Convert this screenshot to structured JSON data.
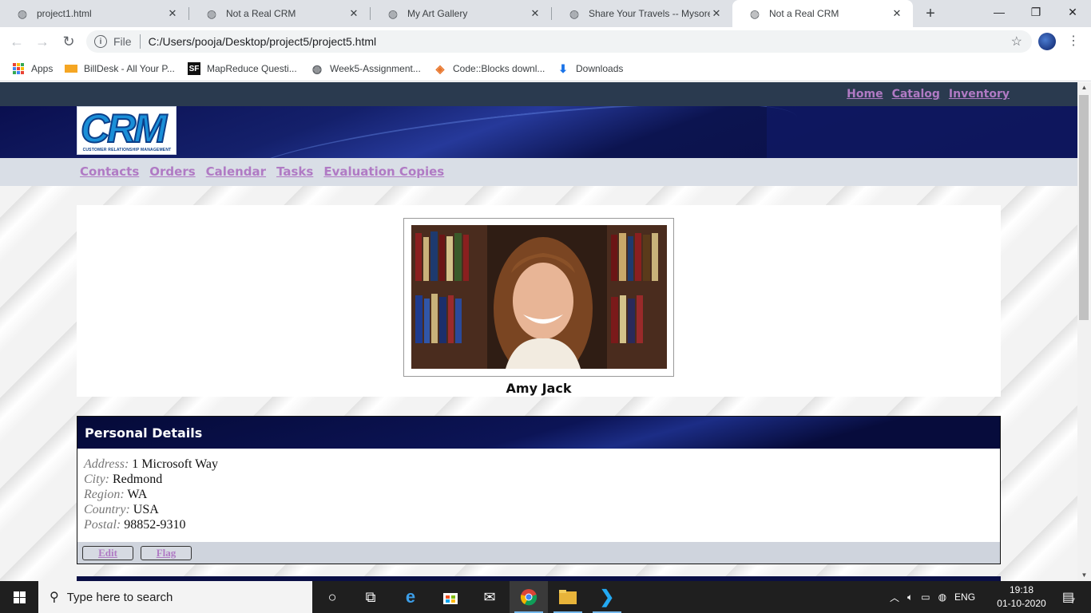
{
  "browser": {
    "tabs": [
      {
        "title": "project1.html"
      },
      {
        "title": "Not a Real CRM"
      },
      {
        "title": "My Art Gallery"
      },
      {
        "title": "Share Your Travels -- Mysore -"
      },
      {
        "title": "Not a Real CRM",
        "active": true
      }
    ],
    "new_tab_icon": "plus-icon",
    "address": {
      "scheme_label": "File",
      "url": "C:/Users/pooja/Desktop/project5/project5.html"
    },
    "bookmarks": [
      {
        "label": "Apps",
        "icon": "apps-grid-icon"
      },
      {
        "label": "BillDesk - All Your P...",
        "icon": "billdesk-icon"
      },
      {
        "label": "MapReduce Questi...",
        "icon": "sf-icon",
        "icon_text": "SF"
      },
      {
        "label": "Week5-Assignment...",
        "icon": "globe-icon"
      },
      {
        "label": "Code::Blocks downl...",
        "icon": "codeblocks-icon"
      },
      {
        "label": "Downloads",
        "icon": "download-icon"
      }
    ]
  },
  "page": {
    "top_links": [
      "Home",
      "Catalog",
      "Inventory"
    ],
    "logo": {
      "text": "CRM",
      "subtitle": "CUSTOMER RELATIONSHIP MANAGEMENT"
    },
    "main_nav": [
      "Contacts",
      "Orders",
      "Calendar",
      "Tasks",
      "Evaluation Copies"
    ],
    "contact_name": "Amy Jack",
    "details": {
      "heading": "Personal Details",
      "fields": [
        {
          "label": "Address:",
          "value": "1 Microsoft Way"
        },
        {
          "label": "City:",
          "value": "Redmond"
        },
        {
          "label": "Region:",
          "value": "WA"
        },
        {
          "label": "Country:",
          "value": "USA"
        },
        {
          "label": "Postal:",
          "value": "98852-9310"
        }
      ],
      "buttons": [
        "Edit",
        "Flag"
      ]
    },
    "colors": {
      "link": "#b07ac4",
      "topbar": "#2a3a4f",
      "nav_bg": "#d9dee6",
      "header_navy": "#0a0f45"
    }
  },
  "taskbar": {
    "search_placeholder": "Type here to search",
    "apps": [
      "cortana-icon",
      "task-view-icon",
      "edge-icon",
      "store-icon",
      "mail-icon",
      "chrome-icon",
      "file-explorer-icon",
      "vscode-icon"
    ],
    "tray": {
      "language": "ENG"
    },
    "clock": {
      "time": "19:18",
      "date": "01-10-2020"
    },
    "notification_count": "7"
  }
}
